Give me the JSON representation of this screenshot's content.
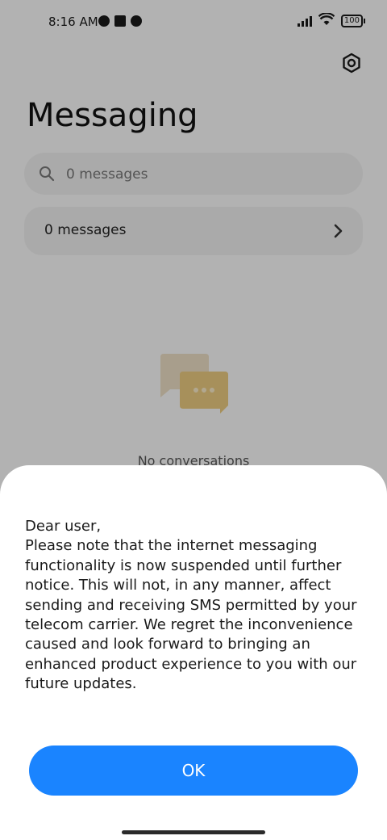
{
  "status_bar": {
    "time": "8:16 AM",
    "battery": "100",
    "left_icons": [
      "notification-icon",
      "square-icon",
      "notification-icon"
    ],
    "right_icons": [
      "signal-icon",
      "wifi-icon",
      "battery-icon"
    ]
  },
  "header": {
    "title": "Messaging",
    "settings_icon": "settings-icon"
  },
  "search": {
    "placeholder": "0 messages",
    "icon": "search-icon"
  },
  "list_row": {
    "label": "0 messages",
    "icon": "chevron-right-icon"
  },
  "empty_state": {
    "illustration": "chat-bubbles-icon",
    "text": "No conversations"
  },
  "dialog": {
    "lines": [
      "Dear user,",
      "Please note that the internet messaging",
      "functionality is now suspended until further",
      "notice. This will not, in any manner, affect",
      "sending and receiving SMS permitted by your",
      "telecom carrier. We regret the inconvenience",
      "caused and look forward to bringing an",
      "enhanced product experience to you with our",
      "future updates."
    ],
    "ok_label": "OK"
  },
  "colors": {
    "accent": "#1a84ff",
    "overlay": "#000000",
    "sheet_background": "#ffffff",
    "illustration_back": "#e9dcc3",
    "illustration_front": "#e8c87f"
  }
}
